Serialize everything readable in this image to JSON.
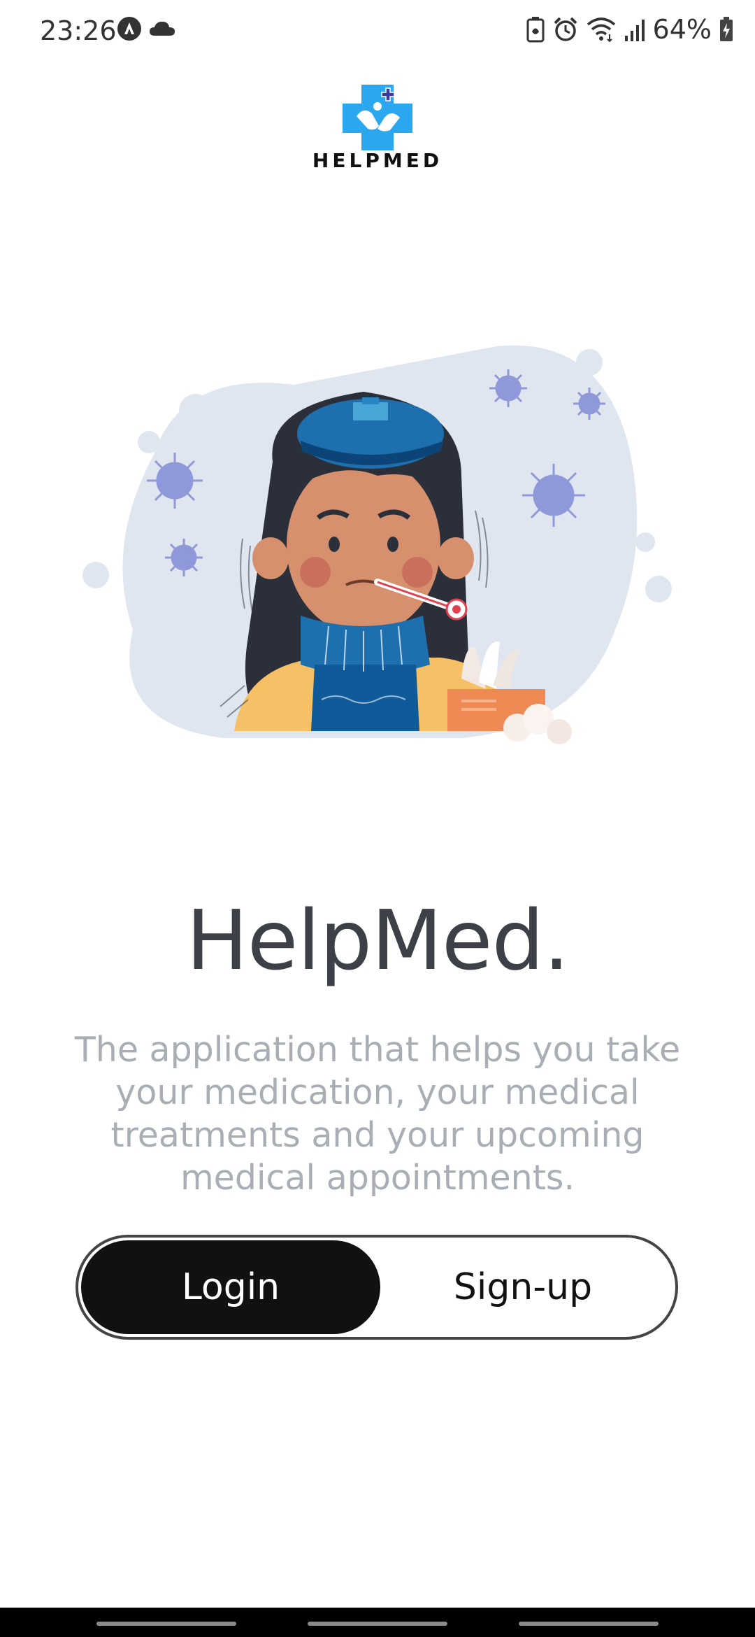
{
  "status_bar": {
    "time": "23:26",
    "battery": "64%",
    "left_icons": [
      "app-notification-icon",
      "cloud-icon"
    ],
    "right_icons": [
      "battery-saver-icon",
      "alarm-icon",
      "wifi-icon",
      "signal-icon",
      "battery-charging-icon"
    ]
  },
  "logo": {
    "name": "HELPMED",
    "icon": "medical-cross-hands-icon",
    "color": "#2ba7f0"
  },
  "illustration": {
    "subject": "sick-woman-illustration"
  },
  "main": {
    "title": "HelpMed.",
    "description": "The application that helps you take your medication, your medical treatments and your upcoming medical appointments."
  },
  "auth": {
    "login_label": "Login",
    "signup_label": "Sign-up",
    "selected": "Login"
  },
  "colors": {
    "primary_dark": "#111111",
    "title_text": "#3d4047",
    "description_text": "#a9adb4",
    "accent_blue": "#2ba7f0"
  }
}
